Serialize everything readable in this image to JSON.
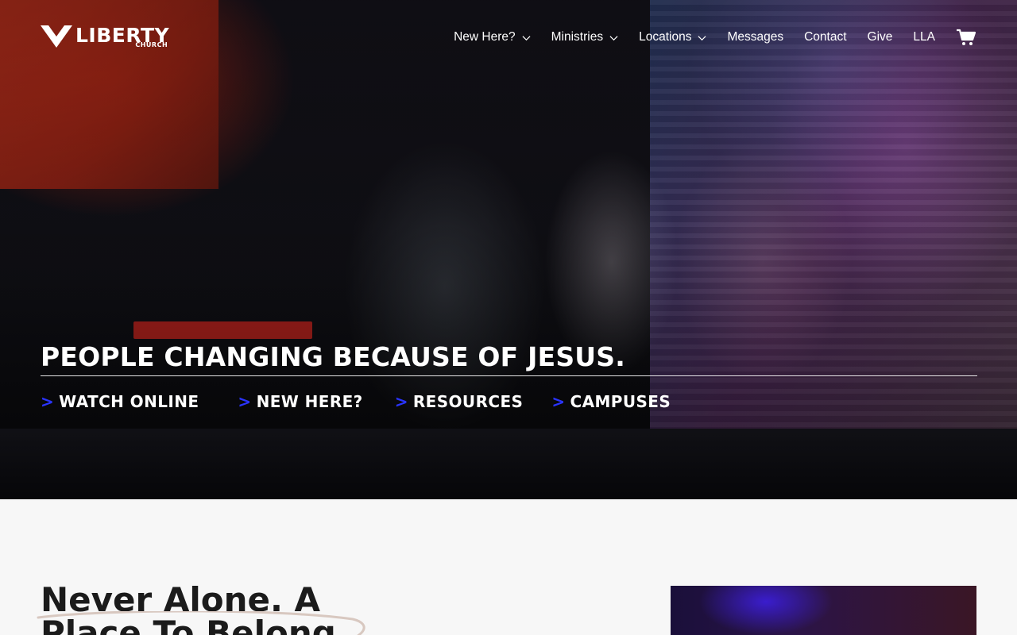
{
  "brand": {
    "name": "LIBERTY",
    "sub": "CHURCH"
  },
  "nav": {
    "items": [
      {
        "label": "New Here?",
        "dropdown": true
      },
      {
        "label": "Ministries",
        "dropdown": true
      },
      {
        "label": "Locations",
        "dropdown": true
      },
      {
        "label": "Messages",
        "dropdown": false
      },
      {
        "label": "Contact",
        "dropdown": false
      },
      {
        "label": "Give",
        "dropdown": false
      },
      {
        "label": "LLA",
        "dropdown": false
      }
    ],
    "cart_icon": "shopping-cart-icon"
  },
  "hero": {
    "tagline": "PEOPLE CHANGING BECAUSE OF JESUS.",
    "links": [
      {
        "prefix": ">",
        "label": "WATCH ONLINE"
      },
      {
        "prefix": ">",
        "label": "NEW HERE?"
      },
      {
        "prefix": ">",
        "label": "RESOURCES"
      },
      {
        "prefix": ">",
        "label": "CAMPUSES"
      }
    ]
  },
  "section": {
    "headline_line1": "Never Alone. A",
    "headline_line2": "Place To Belong"
  },
  "colors": {
    "accent_blue": "#2a34ff",
    "text_dark": "#1b1b1b",
    "page_bg": "#f7f7f7",
    "white": "#ffffff"
  }
}
